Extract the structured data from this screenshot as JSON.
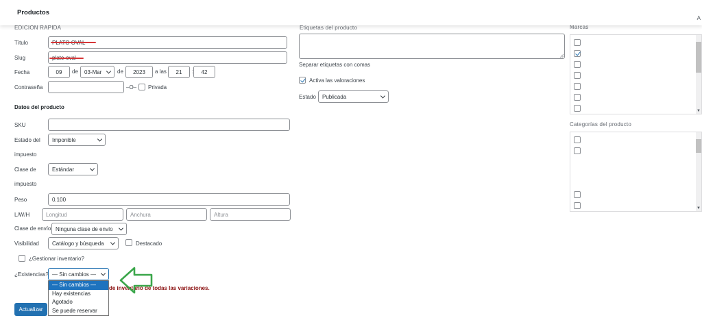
{
  "header": {
    "title": "Productos",
    "help": "A"
  },
  "quick_edit": {
    "section_title": "EDICIÓN RÁPIDA",
    "title_label": "Título",
    "title_value": "PLATO OVAL",
    "slug_label": "Slug",
    "slug_value": "plato-oval",
    "date_label": "Fecha",
    "day": "09",
    "de1": "de",
    "month": "03-Mar",
    "de2": "de",
    "year": "2023",
    "at": "a las",
    "hour": "21",
    "colon": ":",
    "minute": "42",
    "password_label": "Contraseña",
    "or_label": "–O–",
    "private_label": "Privada"
  },
  "product_data": {
    "section_title": "Datos del producto",
    "sku_label": "SKU",
    "tax_status_label_1": "Estado del",
    "tax_status_label_2": "impuesto",
    "tax_status_value": "Imponible",
    "tax_class_label_1": "Clase de",
    "tax_class_label_2": "impuesto",
    "tax_class_value": "Estándar",
    "weight_label": "Peso",
    "weight_value": "0.100",
    "lwh_label": "L/W/H",
    "length_ph": "Longitud",
    "width_ph": "Anchura",
    "height_ph": "Altura",
    "shipping_label": "Clase de envío",
    "shipping_value": "Ninguna clase de envío",
    "visibility_label": "Visibilidad",
    "visibility_value": "Catálogo y búsqueda",
    "featured_label": "Destacado",
    "manage_stock_label": "¿Gestionar inventario?",
    "stock_label": "¿Existencias?",
    "stock_value": "— Sin cambios —",
    "stock_options": [
      "— Sin cambios —",
      "Hay existencias",
      "Agotado",
      "Se puede reservar"
    ],
    "warning_text": "de inventario de todas las variaciones.",
    "update_button": "Actualizar"
  },
  "tags": {
    "section_title": "Etiquetas del producto",
    "hint": "Separar etiquetas con comas",
    "comments_label": "Activa las valoraciones",
    "status_label": "Estado",
    "status_value": "Publicada"
  },
  "right_panel": {
    "brands_title": "Marcas",
    "brands_checked": [
      false,
      true,
      false,
      false,
      false,
      false,
      false
    ],
    "categories_title": "Categorías del producto"
  },
  "colors": {
    "primary": "#2271b1",
    "annotation_arrow": "#3aa64a",
    "redaction": "#d63638",
    "warning": "#8a0f0f"
  }
}
